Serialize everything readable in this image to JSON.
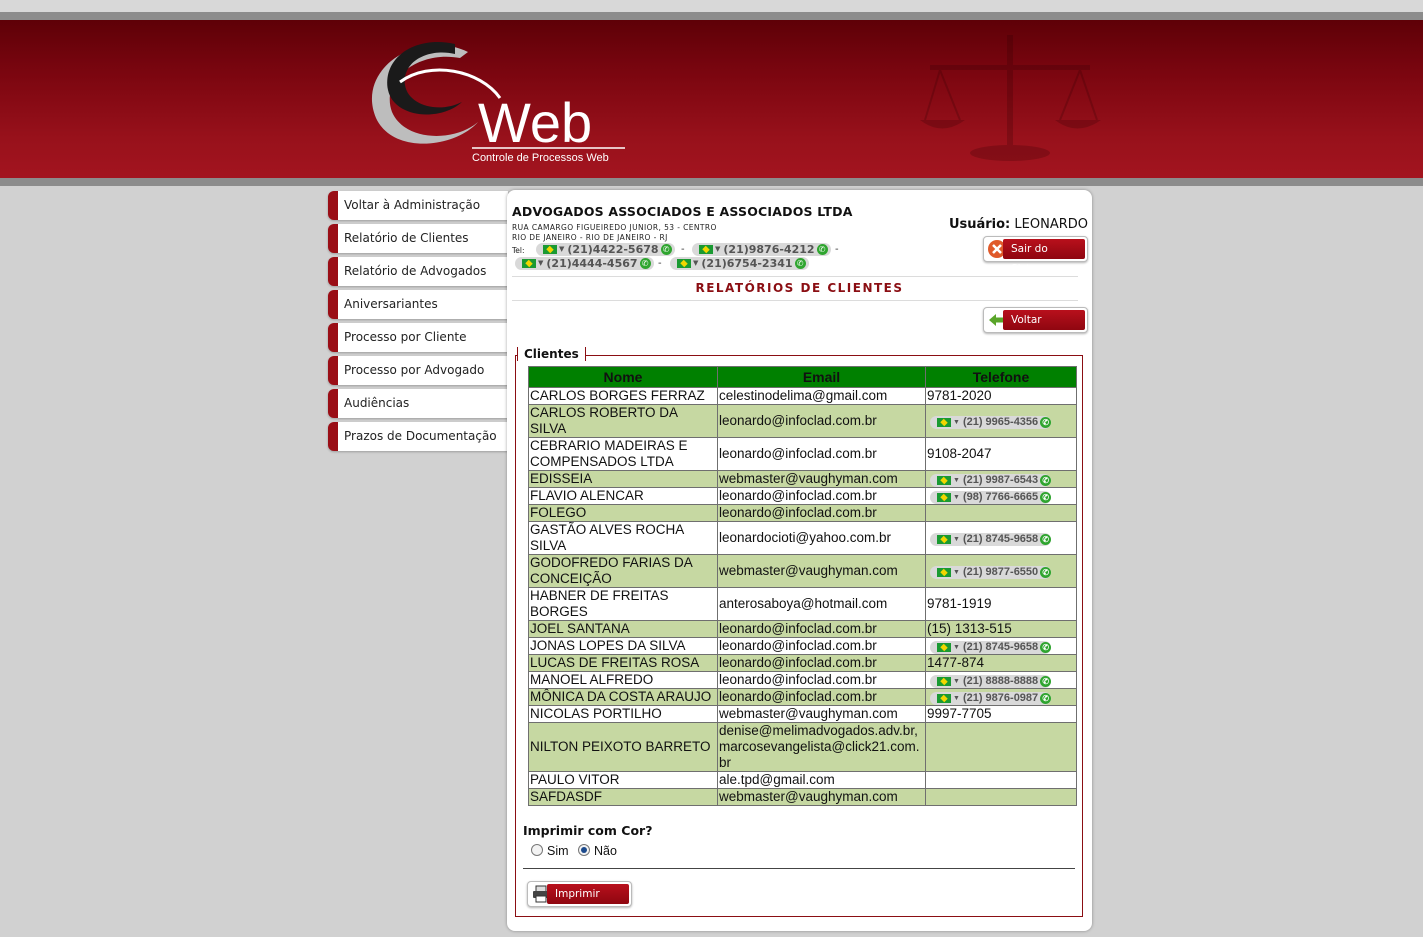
{
  "header": {
    "logo_text": "Web",
    "logo_subtitle": "Controle de Processos Web"
  },
  "sidebar": {
    "items": [
      {
        "label": "Voltar à Administração"
      },
      {
        "label": "Relatório de Clientes"
      },
      {
        "label": "Relatório de Advogados"
      },
      {
        "label": "Aniversariantes"
      },
      {
        "label": "Processo por Cliente"
      },
      {
        "label": "Processo por Advogado"
      },
      {
        "label": "Audiências"
      },
      {
        "label": "Prazos de Documentação"
      }
    ]
  },
  "company": {
    "name": "ADVOGADOS ASSOCIADOS E ASSOCIADOS LTDA",
    "address_line1": "RUA CAMARGO FIGUEIREDO JUNIOR, 53 - CENTRO",
    "address_line2": "RIO DE JANEIRO - RIO DE JANEIRO - RJ",
    "tel_label": "Tel:",
    "phones": [
      "(21)4422-5678",
      "(21)9876-4212",
      "(21)4444-4567",
      "(21)6754-2341"
    ],
    "phone_separator": "-"
  },
  "user": {
    "label": "Usuário:",
    "name": "LEONARDO",
    "logout_label": "Sair do Sistema"
  },
  "page": {
    "title": "RELATÓRIOS DE CLIENTES",
    "back_label": "Voltar",
    "fieldset_legend": "Clientes"
  },
  "table": {
    "columns": [
      "Nome",
      "Email",
      "Telefone"
    ],
    "rows": [
      {
        "nome": "CARLOS BORGES FERRAZ",
        "email": "celestinodelima@gmail.com",
        "telefone": "9781-2020",
        "phone_badge": false
      },
      {
        "nome": "CARLOS ROBERTO DA SILVA",
        "email": "leonardo@infoclad.com.br",
        "telefone": "(21) 9965-4356",
        "phone_badge": true
      },
      {
        "nome": "CEBRARIO MADEIRAS E COMPENSADOS LTDA",
        "email": "leonardo@infoclad.com.br",
        "telefone": "9108-2047",
        "phone_badge": false
      },
      {
        "nome": "EDISSEIA",
        "email": "webmaster@vaughyman.com",
        "telefone": "(21) 9987-6543",
        "phone_badge": true
      },
      {
        "nome": "FLAVIO ALENCAR",
        "email": "leonardo@infoclad.com.br",
        "telefone": "(98) 7766-6665",
        "phone_badge": true
      },
      {
        "nome": "FOLEGO",
        "email": "leonardo@infoclad.com.br",
        "telefone": "",
        "phone_badge": false
      },
      {
        "nome": "GASTÃO ALVES ROCHA SILVA",
        "email": "leonardocioti@yahoo.com.br",
        "telefone": "(21) 8745-9658",
        "phone_badge": true
      },
      {
        "nome": "GODOFREDO FARIAS DA CONCEIÇÃO",
        "email": "webmaster@vaughyman.com",
        "telefone": "(21) 9877-6550",
        "phone_badge": true
      },
      {
        "nome": "HABNER DE FREITAS BORGES",
        "email": "anterosaboya@hotmail.com",
        "telefone": "9781-1919",
        "phone_badge": false
      },
      {
        "nome": "JOEL SANTANA",
        "email": "leonardo@infoclad.com.br",
        "telefone": "(15) 1313-515",
        "phone_badge": false
      },
      {
        "nome": "JONAS LOPES DA SILVA",
        "email": "leonardo@infoclad.com.br",
        "telefone": "(21) 8745-9658",
        "phone_badge": true
      },
      {
        "nome": "LUCAS DE FREITAS ROSA",
        "email": "leonardo@infoclad.com.br",
        "telefone": "1477-874",
        "phone_badge": false
      },
      {
        "nome": "MANOEL ALFREDO",
        "email": "leonardo@infoclad.com.br",
        "telefone": "(21) 8888-8888",
        "phone_badge": true
      },
      {
        "nome": "MÔNICA DA COSTA ARAUJO",
        "email": "leonardo@infoclad.com.br",
        "telefone": "(21) 9876-0987",
        "phone_badge": true
      },
      {
        "nome": "NICOLAS PORTILHO",
        "email": "webmaster@vaughyman.com",
        "telefone": "9997-7705",
        "phone_badge": false
      },
      {
        "nome": "NILTON PEIXOTO BARRETO",
        "email": "denise@melimadvogados.adv.br, marcosevangelista@click21.com.br",
        "telefone": "",
        "phone_badge": false
      },
      {
        "nome": "PAULO VITOR",
        "email": "ale.tpd@gmail.com",
        "telefone": "",
        "phone_badge": false
      },
      {
        "nome": "SAFDASDF",
        "email": "webmaster@vaughyman.com",
        "telefone": "",
        "phone_badge": false
      }
    ]
  },
  "print": {
    "question": "Imprimir com Cor?",
    "option_yes": "Sim",
    "option_no": "Não",
    "selected": "Não",
    "button_label": "Imprimir"
  },
  "colors": {
    "brand_red": "#9a0e16",
    "header_green": "#008000",
    "row_alt": "#c6d8a2"
  }
}
